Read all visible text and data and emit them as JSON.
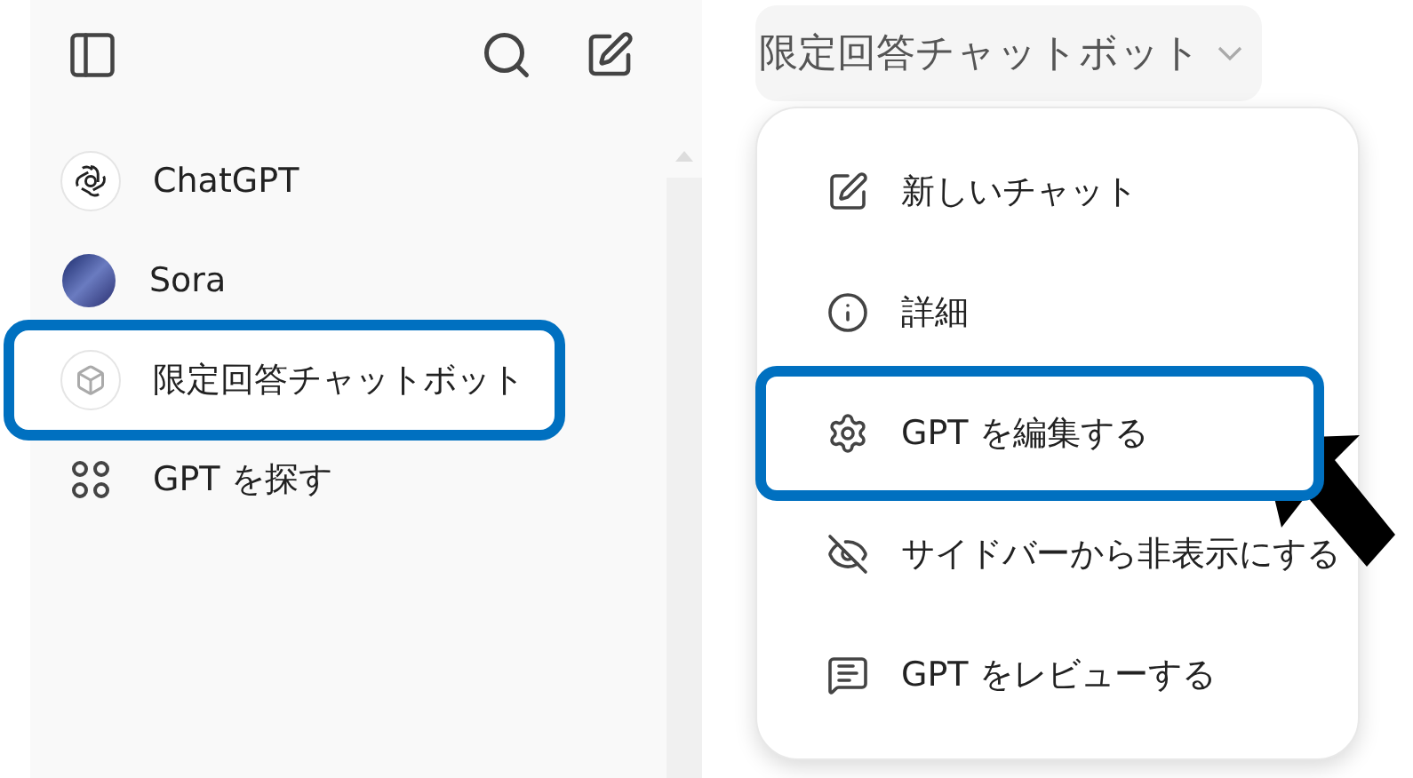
{
  "sidebar": {
    "items": [
      {
        "kind": "chatgpt",
        "label": "ChatGPT",
        "highlighted": false
      },
      {
        "kind": "sora",
        "label": "Sora",
        "highlighted": false
      },
      {
        "kind": "gpt",
        "label": "限定回答チャットボット",
        "highlighted": true
      },
      {
        "kind": "explore",
        "label": "GPT を探す",
        "highlighted": false
      }
    ]
  },
  "header": {
    "title": "限定回答チャットボット"
  },
  "menu": {
    "items": [
      {
        "kind": "new-chat",
        "label": "新しいチャット",
        "highlighted": false
      },
      {
        "kind": "info",
        "label": "詳細",
        "highlighted": false
      },
      {
        "kind": "edit",
        "label": "GPT を編集する",
        "highlighted": true
      },
      {
        "kind": "hide",
        "label": "サイドバーから非表示にする",
        "highlighted": false
      },
      {
        "kind": "review",
        "label": "GPT をレビューする",
        "highlighted": false
      }
    ]
  }
}
